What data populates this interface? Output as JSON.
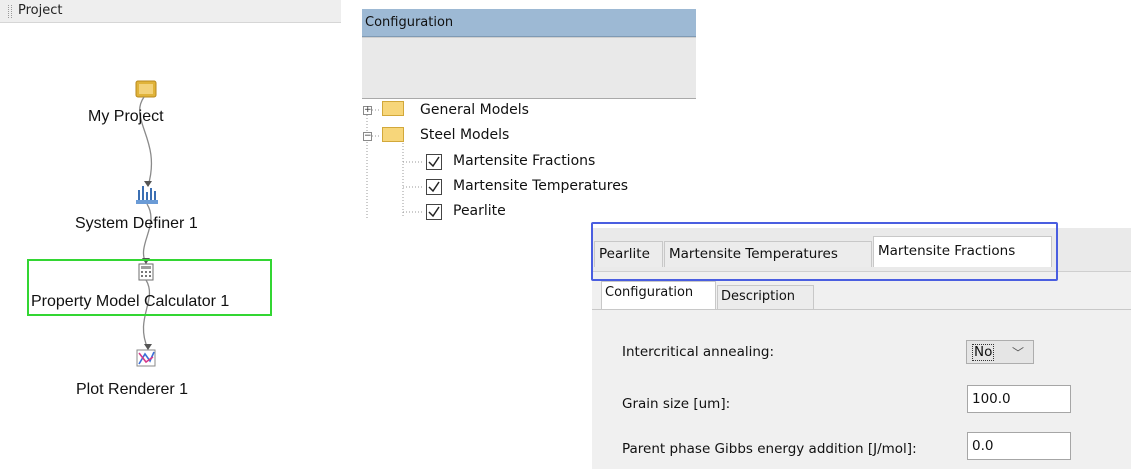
{
  "project_panel": {
    "title": "Project",
    "nodes": [
      {
        "label": "My Project",
        "icon": "folder-icon"
      },
      {
        "label": "System Definer 1",
        "icon": "system-definer-icon"
      },
      {
        "label": "Property Model Calculator 1",
        "icon": "calculator-icon",
        "highlighted": true
      },
      {
        "label": "Plot Renderer 1",
        "icon": "plot-icon"
      }
    ],
    "highlight_color": "#33d633"
  },
  "configuration_panel": {
    "title": "Configuration",
    "header_color": "#9db9d4",
    "tree": [
      {
        "label": "General Models",
        "expander": "+",
        "children": []
      },
      {
        "label": "Steel Models",
        "expander": "−",
        "children": [
          {
            "label": "Martensite Fractions",
            "checked": true
          },
          {
            "label": "Martensite Temperatures",
            "checked": true
          },
          {
            "label": "Pearlite",
            "checked": true
          }
        ]
      }
    ]
  },
  "model_tabs": {
    "tabs": [
      "Pearlite",
      "Martensite Temperatures",
      "Martensite Fractions"
    ],
    "active": "Martensite Fractions",
    "highlight_color": "#4a5ee0",
    "subtabs": [
      "Configuration",
      "Description"
    ],
    "active_subtab": "Configuration"
  },
  "form": {
    "intercritical_annealing": {
      "label": "Intercritical annealing:",
      "value": "No"
    },
    "grain_size": {
      "label": "Grain size [um]:",
      "value": "100.0"
    },
    "gibbs_energy": {
      "label": "Parent phase Gibbs energy addition [J/mol]:",
      "value": "0.0"
    }
  }
}
